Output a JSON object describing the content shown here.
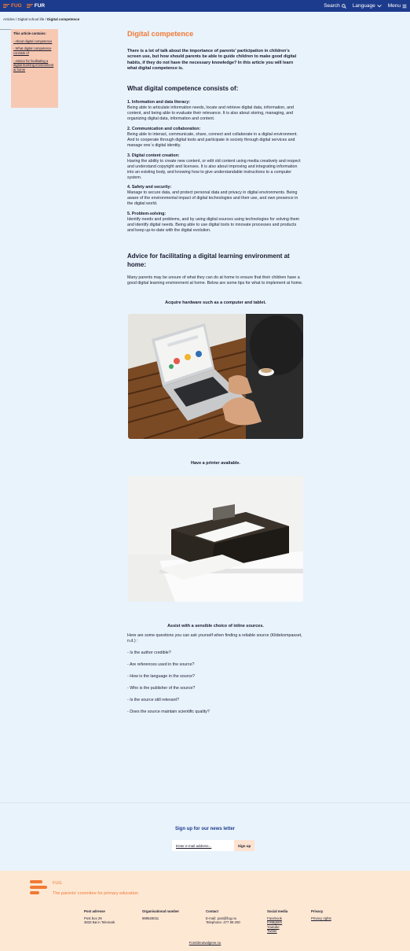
{
  "header": {
    "logo_fug": "FUG",
    "logo_fur": "FUR",
    "search_label": "Search",
    "language_label": "Language",
    "menu_label": "Menu"
  },
  "breadcrumb": {
    "part1": "Articles / ",
    "part2": "Digital school life / ",
    "current": "Digital competence"
  },
  "toc": {
    "title": "This article contains:",
    "links": [
      "- About digital competence",
      "- What digital competence consists of",
      "- Advice for facilitating a digital learning environment at home"
    ]
  },
  "article": {
    "title": "Digital competence",
    "intro": "There is a lot of talk about the importance of parents' participation in children's screen use, but how should parents be able to guide children to make good digital habits, if they do not have the necessary knowledge? In this article you will learn what digital competence is.",
    "section1_title": "What digital competence consists of:",
    "items": [
      {
        "heading": "1. Information and data literacy:",
        "text": "Being able to articulate information needs, locate and retrieve digital data, information, and content, and being able to evaluate their relevance. It is also about storing, managing, and organizing digital data, information and content."
      },
      {
        "heading": "2. Communication and collaboration:",
        "text": "Being able to interact, communicate, share, connect and collaborate in a digital environment. And to cooperate through digital tools and participate in society through digital services and manage one´s digital identity."
      },
      {
        "heading": "3. Digital content creation:",
        "text": "Having the ability to create new content, or edit old content using media creatively and respect and understand copyright and licenses. It is also about improving and integrating information into an existing body, and knowing how to give understandable instructions to a computer system."
      },
      {
        "heading": "4. Safety and security:",
        "text": "Manage to secure data, and protect personal data and privacy in digital environments. Being aware of the environmental impact of digital technologies and their use, and own presence in the digital world."
      },
      {
        "heading": "5. Problem-solving:",
        "text": "Identify needs and problems, and by using digital sources using technologies for solving them and identify digital needs. Being able to use digital tools to innovate processes and products and keep up-to-date with the digital evolution."
      }
    ],
    "section2_title": "Advice for facilitating a digital learning environment at home:",
    "section2_intro": "Many parents may be unsure of what they can do at home to ensure that their children have a good digital learning environment at home. Below are some tips for what to implement at home.",
    "tip1": "Acquire hardware such as a computer and tablet.",
    "tip2": "Have a printer available.",
    "tip3": "Assist with a sensible choice of inline sources.",
    "tip3_intro": "Here are some questions you can ask yourself when finding a reliable source (Kildekompasset, n.d.) :",
    "questions": [
      "- Is the author credible?",
      "- Are references used in the source?",
      "- How is the language in the source?",
      "- Who is the publisher of the source?",
      "- Is the source still relevant?",
      "- Does the source maintain scientific quality?"
    ]
  },
  "newsletter": {
    "title": "Sign up for our news letter",
    "placeholder": "Enter e-mail address...",
    "button": "Sign up"
  },
  "footer": {
    "org_name": "FUG",
    "org_sub": "The parents' commitee for primary education",
    "post_hd": "Post adresse",
    "post_l1": "Post box 29",
    "post_l2": "3833 Bø in Telemark",
    "orgnr_hd": "Organisational number",
    "orgnr": "989628011",
    "contact_hd": "Contact",
    "contact_email": "E-mail: post@fug.no",
    "contact_phone": "Telephone: 477 99 200",
    "social_hd": "Social media",
    "social": [
      "Facebook",
      "Instagram",
      "Youtube",
      "Twitter"
    ],
    "privacy_hd": "Privacy",
    "privacy_link": "Privacy rights",
    "bottom_link": "Foreldreutvalgene.no"
  },
  "colors": {
    "topbar": "#1d3b8c",
    "accent": "#f07a35",
    "background": "#e9f3fc",
    "toc_bg": "#f7c9b3",
    "footer_bg": "#fde8d4"
  }
}
